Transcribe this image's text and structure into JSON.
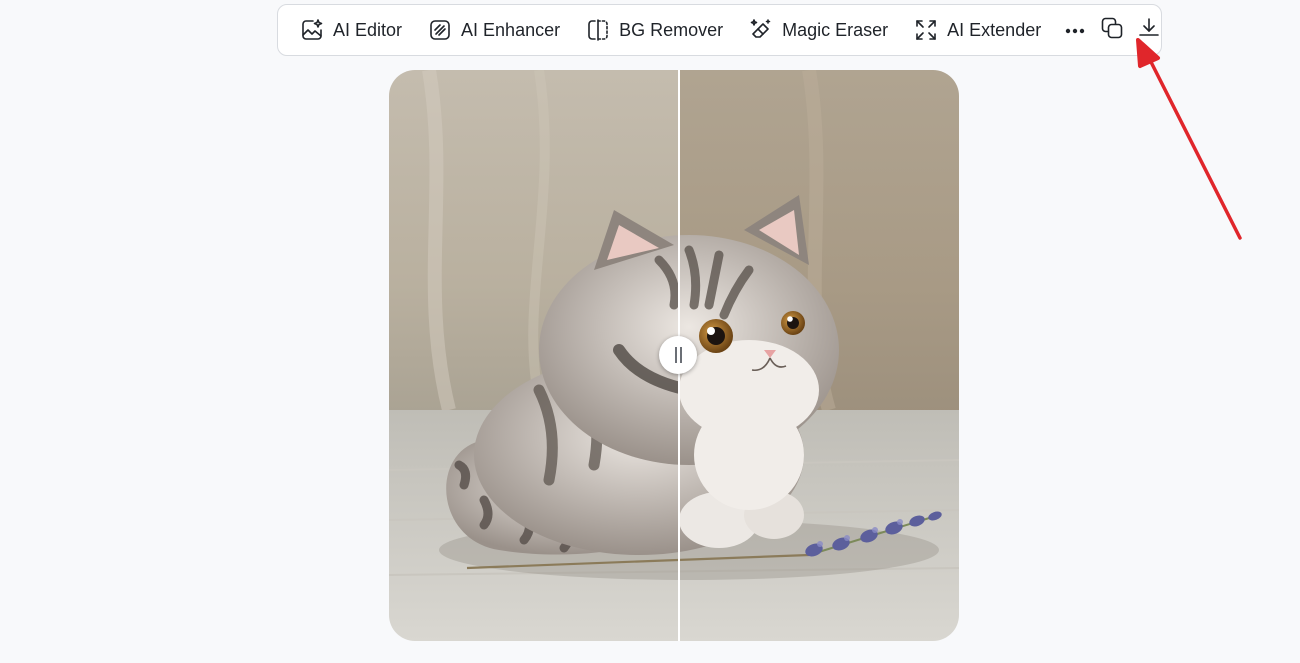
{
  "toolbar": {
    "tools": [
      {
        "label": "AI Editor",
        "icon": "ai-editor-icon"
      },
      {
        "label": "AI Enhancer",
        "icon": "ai-enhancer-icon"
      },
      {
        "label": "BG Remover",
        "icon": "bg-remover-icon"
      },
      {
        "label": "Magic Eraser",
        "icon": "magic-eraser-icon"
      },
      {
        "label": "AI Extender",
        "icon": "ai-extender-icon"
      }
    ],
    "more_icon": "more-dots-icon",
    "copy_icon": "copy-icon",
    "download_icon": "download-icon"
  },
  "compare": {
    "image": "felt cat figurine with lavender sprig",
    "handle_icon": "compare-slider-handle-icon",
    "split_fraction": 0.51
  },
  "annotation": {
    "arrow_color": "#e0262b",
    "target": "download-button"
  },
  "colors": {
    "background": "#f8f9fb",
    "toolbar_border": "#d8dbe0",
    "text": "#1f2329"
  }
}
